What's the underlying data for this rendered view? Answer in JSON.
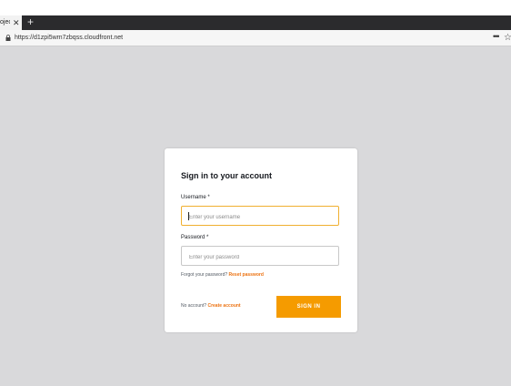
{
  "browser": {
    "tab_title": "oject",
    "tab_close": "✕",
    "new_tab": "+",
    "url": "https://d1zpi5wm7zbqss.cloudfront.net",
    "more": "•••",
    "star": "☆"
  },
  "form": {
    "title": "Sign in to your account",
    "username_label": "Username *",
    "username_placeholder": "Enter your username",
    "password_label": "Password *",
    "password_placeholder": "Enter your password",
    "forgot_text": "Forgot your password?",
    "reset_link": "Reset password",
    "no_account_text": "No account?",
    "create_link": "Create account",
    "signin_label": "SIGN IN"
  },
  "colors": {
    "accent": "#f59b00",
    "link": "#ec7211",
    "focus_border": "#f0b030",
    "page_bg": "#d9d9db"
  }
}
